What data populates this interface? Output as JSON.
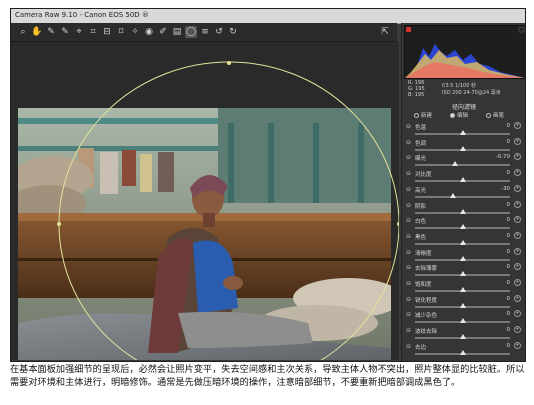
{
  "window": {
    "title": "Camera Raw 9.10 - Canon EOS 50D ®"
  },
  "toolbar": {
    "tools": [
      {
        "name": "zoom-tool-icon",
        "glyph": "⌕"
      },
      {
        "name": "hand-tool-icon",
        "glyph": "✋"
      },
      {
        "name": "white-balance-tool-icon",
        "glyph": "✎"
      },
      {
        "name": "color-sampler-tool-icon",
        "glyph": "✎"
      },
      {
        "name": "targeted-adjustment-tool-icon",
        "glyph": "⌖"
      },
      {
        "name": "crop-tool-icon",
        "glyph": "⌗"
      },
      {
        "name": "straighten-tool-icon",
        "glyph": "⊟"
      },
      {
        "name": "transform-tool-icon",
        "glyph": "⌑"
      },
      {
        "name": "spot-removal-tool-icon",
        "glyph": "✧"
      },
      {
        "name": "red-eye-tool-icon",
        "glyph": "◉"
      },
      {
        "name": "adjustment-brush-icon",
        "glyph": "✐"
      },
      {
        "name": "graduated-filter-icon",
        "glyph": "▤"
      },
      {
        "name": "radial-filter-icon",
        "glyph": "◯"
      },
      {
        "name": "preferences-icon",
        "glyph": "≡"
      },
      {
        "name": "rotate-ccw-icon",
        "glyph": "↺"
      },
      {
        "name": "rotate-cw-icon",
        "glyph": "↻"
      }
    ],
    "fullscreen_glyph": "⇱"
  },
  "panel": {
    "rgb_readout": {
      "r": "R: 198",
      "g": "G: 195",
      "b": "B: 195"
    },
    "exif": {
      "line1": "f/3.5   1/100 秒",
      "line2": "ISO 200   24-70@24 毫米"
    },
    "title": "径向滤镜",
    "modes": [
      {
        "label": "新建",
        "selected": false
      },
      {
        "label": "编辑",
        "selected": true
      },
      {
        "label": "画笔",
        "selected": false
      }
    ],
    "sliders": [
      {
        "label": "色温",
        "value": "0",
        "pos": 0.5
      },
      {
        "label": "色调",
        "value": "0",
        "pos": 0.5
      },
      {
        "label": "曝光",
        "value": "-0.70",
        "pos": 0.42
      },
      {
        "label": "对比度",
        "value": "0",
        "pos": 0.5
      },
      {
        "label": "高光",
        "value": "-30",
        "pos": 0.4
      },
      {
        "label": "阴影",
        "value": "0",
        "pos": 0.5
      },
      {
        "label": "白色",
        "value": "0",
        "pos": 0.5
      },
      {
        "label": "黑色",
        "value": "0",
        "pos": 0.5
      },
      {
        "label": "清晰度",
        "value": "0",
        "pos": 0.5
      },
      {
        "label": "去除薄雾",
        "value": "0",
        "pos": 0.5
      },
      {
        "label": "饱和度",
        "value": "0",
        "pos": 0.5
      },
      {
        "label": "锐化程度",
        "value": "0",
        "pos": 0.5
      },
      {
        "label": "减少杂色",
        "value": "0",
        "pos": 0.5
      },
      {
        "label": "波纹去除",
        "value": "0",
        "pos": 0.5
      },
      {
        "label": "去边",
        "value": "0",
        "pos": 0.5
      }
    ]
  },
  "caption": "在基本面板加强细节的呈现后，必然会让照片变平，失去空间感和主次关系，导致主体人物不突出，照片整体显的比较脏。所以需要对环境和主体进行，明暗修饰。通常是先做压暗环境的操作，注意暗部细节，不要重新把暗部调成黑色了。"
}
